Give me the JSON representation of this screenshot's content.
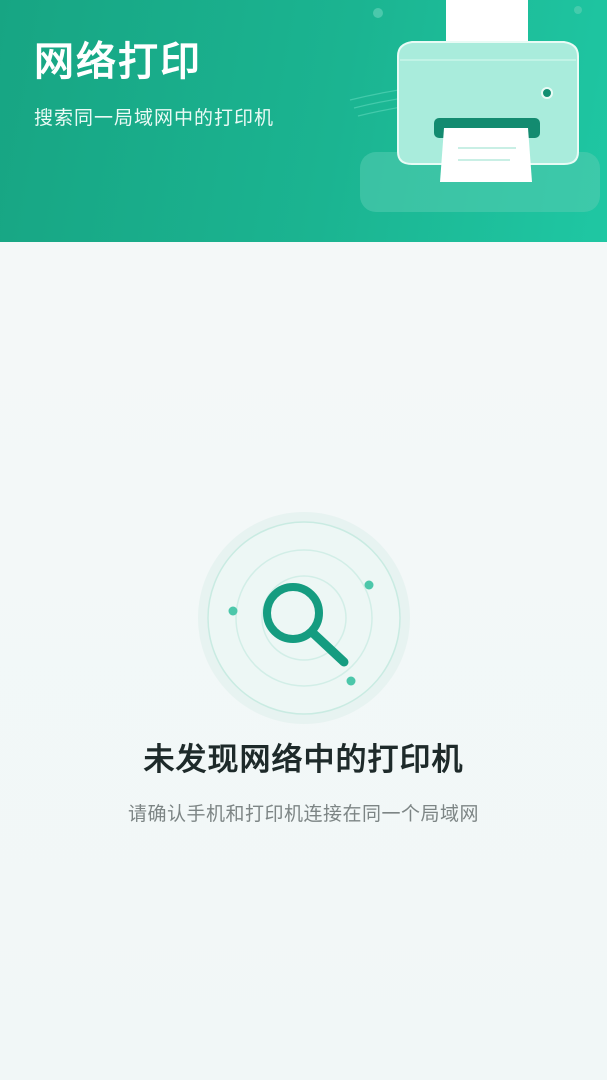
{
  "header": {
    "title": "网络打印",
    "subtitle": "搜索同一局域网中的打印机"
  },
  "empty_state": {
    "title": "未发现网络中的打印机",
    "hint": "请确认手机和打印机连接在同一个局域网"
  },
  "icons": {
    "printer": "printer-icon",
    "search": "search-icon"
  },
  "colors": {
    "brand": "#17a583",
    "brand_light": "#1fc7a3",
    "accent": "#159c80",
    "background": "#f3f7f7",
    "title_text": "#1e2a2a",
    "hint_text": "#7d8585"
  }
}
